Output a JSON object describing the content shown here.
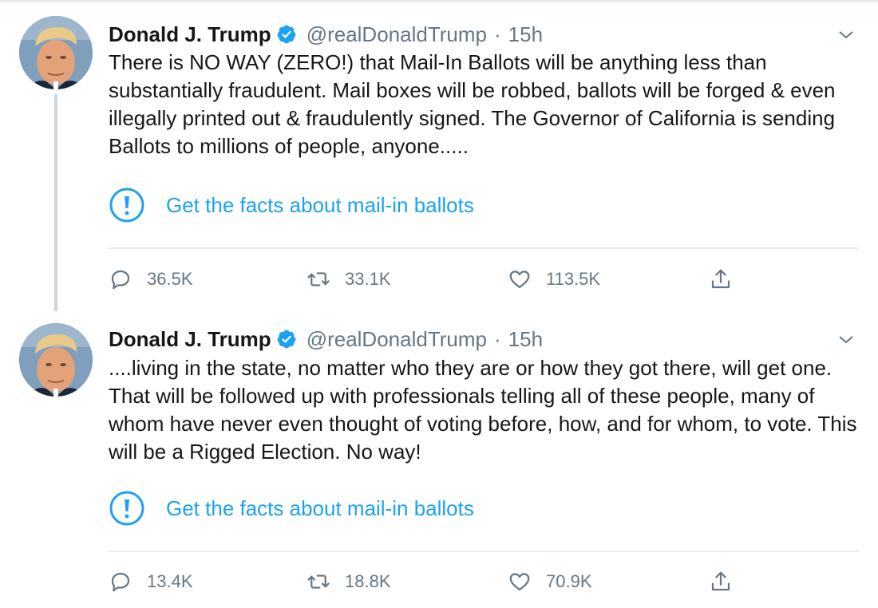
{
  "colors": {
    "accent": "#1da1f2",
    "text_primary": "#14171a",
    "text_secondary": "#657786",
    "divider": "#e6ecf0",
    "thread_line": "#ccd6dd"
  },
  "tweets": [
    {
      "author_name": "Donald J. Trump",
      "handle": "@realDonaldTrump",
      "separator": "·",
      "time": "15h",
      "text": "There is NO WAY (ZERO!) that Mail-In Ballots will be anything less than substantially fraudulent. Mail boxes will be robbed, ballots will be forged & even illegally printed out & fraudulently signed. The Governor of California is sending Ballots to millions of people, anyone.....",
      "facts_label": "Get the facts about mail-in ballots",
      "replies": "36.5K",
      "retweets": "33.1K",
      "likes": "113.5K",
      "icons": [
        "verified-badge-icon",
        "chevron-down-icon",
        "exclamation-circle-icon",
        "reply-icon",
        "retweet-icon",
        "heart-icon",
        "share-icon"
      ]
    },
    {
      "author_name": "Donald J. Trump",
      "handle": "@realDonaldTrump",
      "separator": "·",
      "time": "15h",
      "text": "....living in the state, no matter who they are or how they got there, will get one. That will be followed up with professionals telling all of these people, many of whom have never even thought of voting before, how, and for whom, to vote. This will be a Rigged Election. No way!",
      "facts_label": "Get the facts about mail-in ballots",
      "replies": "13.4K",
      "retweets": "18.8K",
      "likes": "70.9K",
      "icons": [
        "verified-badge-icon",
        "chevron-down-icon",
        "exclamation-circle-icon",
        "reply-icon",
        "retweet-icon",
        "heart-icon",
        "share-icon"
      ]
    }
  ]
}
